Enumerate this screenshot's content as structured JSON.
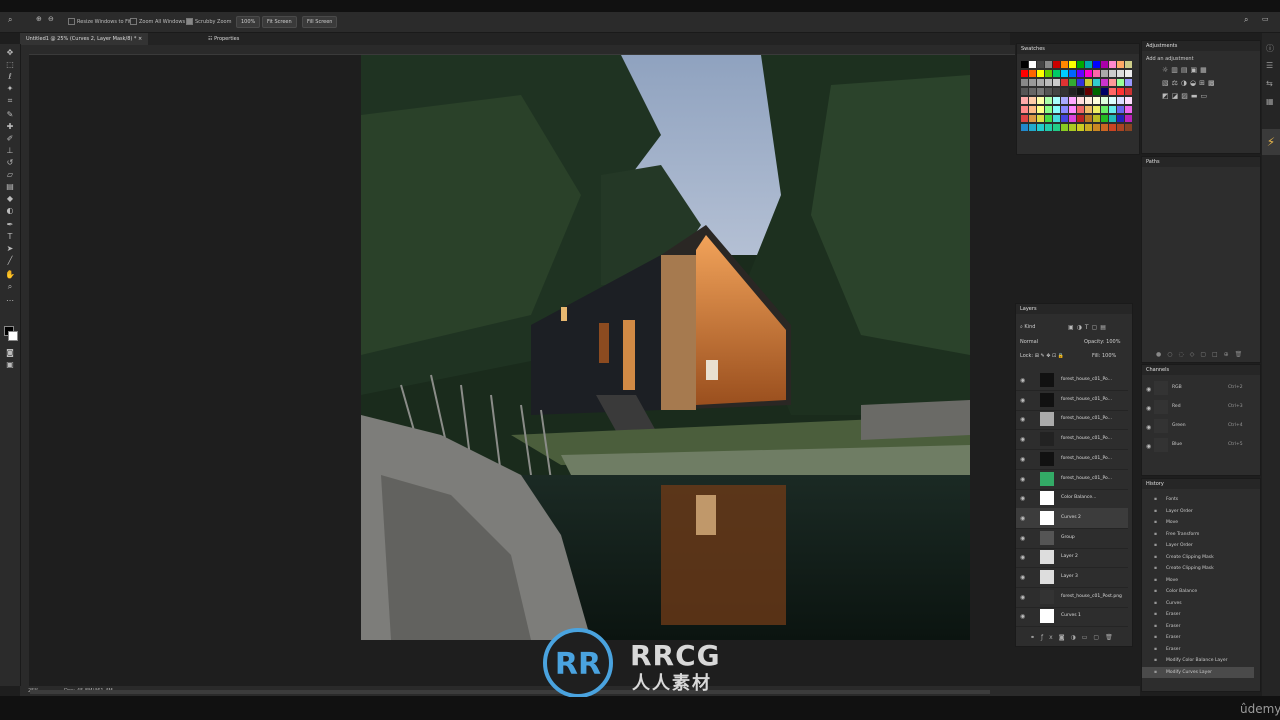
{
  "options_bar": {
    "resize_windows": "Resize Windows to Fit",
    "zoom_all": "Zoom All Windows",
    "scrubby_zoom": "Scrubby Zoom",
    "zoom_value": "100%",
    "fit_screen": "Fit Screen",
    "fill_screen": "Fill Screen"
  },
  "document_tab": "Untitled1 @ 25% (Curves 2, Layer Mask/8) *",
  "properties_tab": "Properties",
  "status": {
    "zoom": "25%",
    "doc": "Doc: 45.8M/461.4M"
  },
  "swatches_panel": {
    "title": "Swatches"
  },
  "adjustments_panel": {
    "title": "Adjustments",
    "subtitle": "Add an adjustment"
  },
  "paths_panel": {
    "title": "Paths"
  },
  "layers_panel": {
    "title": "Layers",
    "kind": "Kind",
    "blend_mode": "Normal",
    "opacity_label": "Opacity:",
    "opacity_value": "100%",
    "lock_label": "Lock:",
    "fill_label": "Fill:",
    "fill_value": "100%",
    "layers": [
      {
        "name": "forest_house_c01_Po..."
      },
      {
        "name": "forest_house_c01_Po..."
      },
      {
        "name": "forest_house_c01_Po..."
      },
      {
        "name": "forest_house_c01_Po..."
      },
      {
        "name": "forest_house_c01_Po..."
      },
      {
        "name": "forest_house_c01_Po..."
      },
      {
        "name": "Color Balance..."
      },
      {
        "name": "Curves 2"
      },
      {
        "name": "Group"
      },
      {
        "name": "Layer 2"
      },
      {
        "name": "Layer 3"
      },
      {
        "name": "forest_house_c01_Post.png"
      },
      {
        "name": "Curves 1"
      }
    ]
  },
  "channels_panel": {
    "title": "Channels",
    "channels": [
      {
        "name": "RGB",
        "shortcut": "Ctrl+2"
      },
      {
        "name": "Red",
        "shortcut": "Ctrl+3"
      },
      {
        "name": "Green",
        "shortcut": "Ctrl+4"
      },
      {
        "name": "Blue",
        "shortcut": "Ctrl+5"
      }
    ]
  },
  "history_panel": {
    "title": "History",
    "items": [
      "Fonts",
      "Layer Order",
      "Move",
      "Free Transform",
      "Layer Order",
      "Create Clipping Mask",
      "Create Clipping Mask",
      "Move",
      "Color Balance",
      "Curves",
      "Eraser",
      "Eraser",
      "Eraser",
      "Eraser",
      "Modify Color Balance Layer",
      "Modify Curves Layer"
    ]
  },
  "watermark": {
    "brand": "RRCG",
    "sub": "人人素材"
  },
  "udemy": "ûdemy",
  "colors": {
    "accent": "#4aa3df"
  }
}
